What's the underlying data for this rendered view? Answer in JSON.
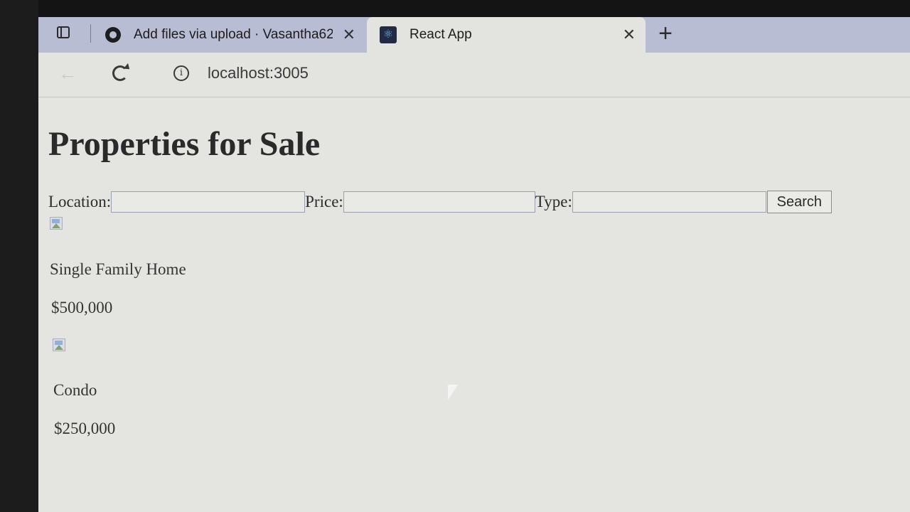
{
  "browser": {
    "tabs": [
      {
        "title": "Add files via upload · Vasantha62",
        "active": false,
        "favicon": "github-icon"
      },
      {
        "title": "React App",
        "active": true,
        "favicon": "react-icon"
      }
    ],
    "close_glyph": "✕",
    "new_tab_glyph": "+",
    "url": "localhost:3005"
  },
  "page": {
    "title": "Properties for Sale",
    "form": {
      "location_label": "Location:",
      "location_value": "",
      "price_label": "Price:",
      "price_value": "",
      "type_label": "Type:",
      "type_value": "",
      "search_label": "Search"
    },
    "properties": [
      {
        "name": "Single Family Home",
        "price": "$500,000"
      },
      {
        "name": "Condo",
        "price": "$250,000"
      }
    ]
  },
  "colors": {
    "tabstrip": "#b9bdd4",
    "page_background": "#e4e4e0",
    "text": "#2c2c2c"
  }
}
